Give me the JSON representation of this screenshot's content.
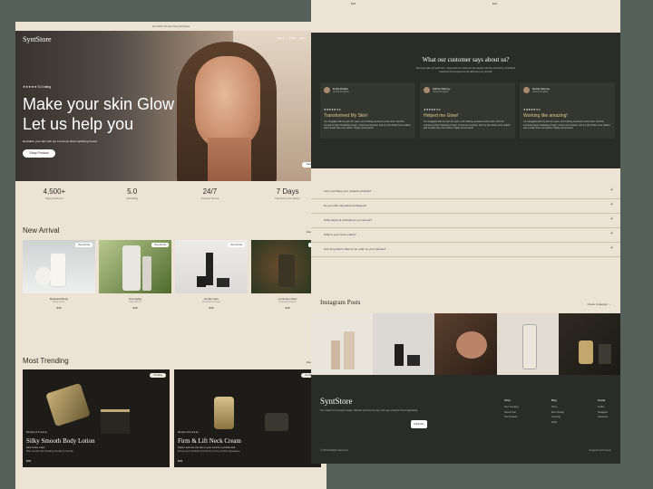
{
  "announcement": "Get 20% off your first purchase",
  "brand": "SyntStore",
  "nav": [
    "Home",
    "Shop",
    "Blog",
    "Contact"
  ],
  "hero": {
    "rating": "★★★★★ 5.0 rating",
    "title_line1": "Make your skin Glow",
    "title_line2": "Let us help you",
    "subtitle": "Revitalize your skin with our Luminous Glow Hydrating Cream",
    "cta": "Shop Product",
    "chip": "View Product"
  },
  "stats": [
    {
      "value": "4,500+",
      "label": "Happy Customers"
    },
    {
      "value": "5.0",
      "label": "Star Rating"
    },
    {
      "value": "24/7",
      "label": "Customer Service"
    },
    {
      "value": "7 Days",
      "label": "Fast and secure delivery"
    }
  ],
  "new_arrival": {
    "title": "New Arrival",
    "view_all": "View All →",
    "items": [
      {
        "name": "Botanical Body",
        "sub": "Body Lotion",
        "price": "$48",
        "tag": "New Arrival"
      },
      {
        "name": "Anti-Aging",
        "sub": "Face Serum",
        "price": "$48",
        "tag": "New Arrival"
      },
      {
        "name": "Gentle Care",
        "sub": "Nourishing Cream",
        "price": "$48",
        "tag": "New Arrival"
      },
      {
        "name": "Luminous Glow",
        "sub": "Hydrating Cream",
        "price": "$48",
        "tag": "New In"
      }
    ]
  },
  "trending": {
    "title": "Most Trending",
    "view_all": "View All →",
    "items": [
      {
        "tag": "Trending",
        "rating": "Reviews (4.9 ★★★)",
        "name": "Silky Smooth Body Lotion",
        "d1": "Dark circles cream",
        "d2": "Silky smooth and hydrating formula for the skin",
        "price": "$78"
      },
      {
        "tag": "Trending",
        "rating": "Reviews (4.9 ★★★)",
        "name": "Firm & Lift Neck Cream",
        "d1": "Tighten and tone the skin on your neck for a youthful look",
        "d2": "Firming and hydrating formula for a more youthful appearance",
        "price": "$78"
      }
    ]
  },
  "right_prices": [
    "$48",
    "$48"
  ],
  "testimonials": {
    "title": "What our customer says about us?",
    "sub1": "Don't just take our word for it - hear what our customers are saying! Join the community of satisfied",
    "sub2": "customers and experience the difference for yourself.",
    "cards": [
      {
        "name": "Emily Parker",
        "loc": "United Kingdom",
        "stars": "★★★★★ 5.0",
        "head": "Transformed My Skin!",
        "body": "I've struggled with dry skin for years, and nothing seemed to work until I tried the Luminous Glow Hydrating Cream. It feels so luxurious, and my skin looks more radiant and smooth than ever before. Highly recommend!"
      },
      {
        "name": "Ashton McCoy",
        "loc": "United Kingdom",
        "stars": "★★★★★ 5.0",
        "head": "Helped me Glow!",
        "body": "I've struggled with dry skin for years, and nothing seemed to work until I tried the Luminous Glow Hydrating Cream. It feels so luxurious, and my skin looks more radiant and smooth than ever before. Highly recommend!"
      },
      {
        "name": "Nicole Sizemo",
        "loc": "United Kingdom",
        "stars": "★★★★★ 5.0",
        "head": "Working like amazing!",
        "body": "I've struggled with dry skin for years, and nothing seemed to work until I tried the Luminous Glow Hydrating Cream. It feels so luxurious, and my skin looks more radiant and smooth than ever before. Highly recommend!"
      }
    ]
  },
  "faq": [
    "Can I purchase your medical products?",
    "Do you offer international shipping?",
    "What payment methods do you accept?",
    "What is your return policy?",
    "How long does it take for an order on your website?"
  ],
  "instagram": {
    "title": "Instagram Posts",
    "link": "Check Instagram →"
  },
  "footer": {
    "logo": "SyntStore",
    "desc": "Our mission is to provide simple, effective skincare for every skin type using the finest ingredients.",
    "subscribe": "Subscribe",
    "cols": [
      {
        "h": "Shop",
        "items": [
          "New Trending",
          "New Arrival",
          "Hot Products"
        ]
      },
      {
        "h": "Blog",
        "items": [
          "Home",
          "Best Posting",
          "Trending",
          "FAQs"
        ]
      },
      {
        "h": "Social",
        "items": [
          "Twitter",
          "Instagram",
          "Facebook"
        ]
      }
    ],
    "copyright": "© 2024 All Rights Reserved",
    "powered": "Designed with Framer"
  }
}
